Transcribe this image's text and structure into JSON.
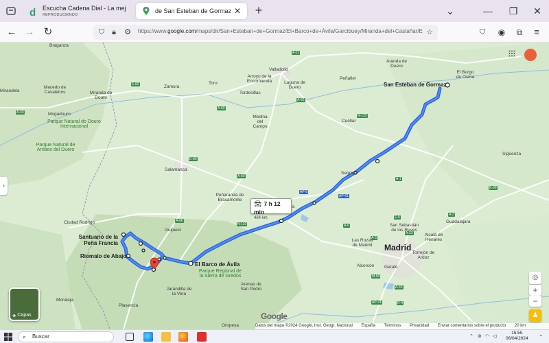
{
  "tabs": [
    {
      "title": "Escucha Cadena Dial - La mejor música en e",
      "subtitle": "REPRODUCIENDO",
      "favicon": "cadena-dial-icon"
    },
    {
      "title": "de San Esteban de Gormaz a Baños de Mo",
      "favicon": "google-maps-icon",
      "active": true
    }
  ],
  "address_bar": {
    "url_prefix": "https://www.",
    "url_domain": "google.com",
    "url_rest": "/maps/dir/San+Esteban+de+Gormaz/El+Barco+de+Ávila/Garcibuey/Miranda+del+Castañar/El+Cabaco/"
  },
  "map": {
    "places": [
      {
        "text": "Braganza",
        "cls": "lbl"
      },
      {
        "text": "Mirandela",
        "cls": "lbl"
      },
      {
        "text": "Macedo de Cavaleiros",
        "cls": "lbl"
      },
      {
        "text": "Miranda do Douro",
        "cls": "lbl"
      },
      {
        "text": "Mogadouro",
        "cls": "lbl"
      },
      {
        "text": "Valladolid",
        "cls": "lbl"
      },
      {
        "text": "Arroyo de la Encomienda",
        "cls": "lbl"
      },
      {
        "text": "Zamora",
        "cls": "lbl"
      },
      {
        "text": "Toro",
        "cls": "lbl"
      },
      {
        "text": "Tordesillas",
        "cls": "lbl"
      },
      {
        "text": "Laguna de Duero",
        "cls": "lbl"
      },
      {
        "text": "Peñafiel",
        "cls": "lbl"
      },
      {
        "text": "Aranda de Duero",
        "cls": "lbl"
      },
      {
        "text": "El Burgo de Osma",
        "cls": "lbl"
      },
      {
        "text": "Medina del Campo",
        "cls": "lbl"
      },
      {
        "text": "Cuéllar",
        "cls": "lbl"
      },
      {
        "text": "Salamanca",
        "cls": "lbl"
      },
      {
        "text": "Peñaranda de Bracamonte",
        "cls": "lbl"
      },
      {
        "text": "Ávila",
        "cls": "lbl"
      },
      {
        "text": "Sigüenza",
        "cls": "lbl"
      },
      {
        "text": "Guadalajara",
        "cls": "lbl"
      },
      {
        "text": "Alcalá de Henares",
        "cls": "lbl"
      },
      {
        "text": "San Sebastián de los Reyes",
        "cls": "lbl"
      },
      {
        "text": "Las Rozas de Madrid",
        "cls": "lbl"
      },
      {
        "text": "Madrid",
        "cls": "lbl xl"
      },
      {
        "text": "Torrejón de Ardoz",
        "cls": "lbl"
      },
      {
        "text": "Alcorcón",
        "cls": "lbl"
      },
      {
        "text": "Getafe",
        "cls": "lbl"
      },
      {
        "text": "Ciudad Rodrigo",
        "cls": "lbl"
      },
      {
        "text": "Guijuelo",
        "cls": "lbl"
      },
      {
        "text": "Arenas de San Pedro",
        "cls": "lbl"
      },
      {
        "text": "Jarandilla de la Vera",
        "cls": "lbl"
      },
      {
        "text": "Moraleja",
        "cls": "lbl"
      },
      {
        "text": "Plasencia",
        "cls": "lbl"
      },
      {
        "text": "Oropesa",
        "cls": "lbl"
      },
      {
        "text": "Segovia",
        "cls": "lbl"
      }
    ],
    "parks": [
      "Parque Natural do Douro Internacional",
      "Parque Natural de Arribes del Duero",
      "Parque Regional de la Sierra de Gredos"
    ],
    "waypoints": {
      "start": "San Esteban de Gormaz",
      "barco": "El Barco de Ávila",
      "santuario": "Santuario de la Peña Francia",
      "riomalo": "Riomalo de Abajo"
    },
    "road_badges": [
      "A-11",
      "A-62",
      "N-122",
      "A-60",
      "A-50",
      "A-1",
      "AP-6",
      "AP-61",
      "A-6",
      "E-82",
      "N-110",
      "A-66",
      "E-80",
      "E-90",
      "M-50",
      "AP-41",
      "R-4",
      "A-5",
      "A-2",
      "E-5",
      "A-23",
      "A-42",
      "A-43"
    ],
    "route_duration": "7 h 12 min",
    "route_distance": "464 km",
    "layers_label": "Capas",
    "google_logo": "Google",
    "footer": [
      "Datos del mapa ©2024 Google, Inst. Geogr. Nacional",
      "España",
      "Términos",
      "Privacidad",
      "Enviar comentarios sobre el producto",
      "20 km"
    ]
  },
  "taskbar": {
    "search_label": "Buscar",
    "time": "15:55",
    "date": "06/04/2024"
  }
}
